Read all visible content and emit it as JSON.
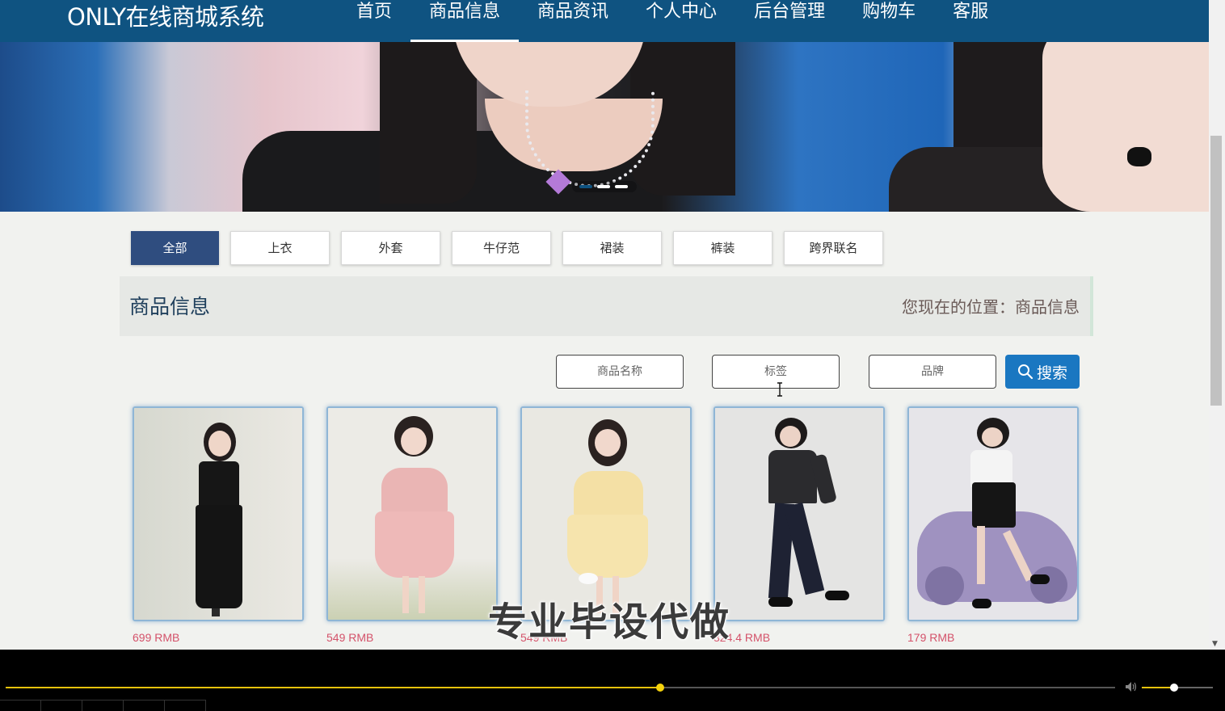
{
  "site": {
    "title": "ONLY在线商城系统"
  },
  "nav": {
    "items": [
      {
        "label": "首页"
      },
      {
        "label": "商品信息",
        "active": true
      },
      {
        "label": "商品资讯"
      },
      {
        "label": "个人中心"
      },
      {
        "label": "后台管理"
      },
      {
        "label": "购物车"
      },
      {
        "label": "客服"
      }
    ]
  },
  "banner": {
    "slides": 3,
    "active_slide": 1
  },
  "categories": [
    {
      "label": "全部",
      "active": true
    },
    {
      "label": "上衣"
    },
    {
      "label": "外套"
    },
    {
      "label": "牛仔范"
    },
    {
      "label": "裙装"
    },
    {
      "label": "裤装"
    },
    {
      "label": "跨界联名"
    }
  ],
  "section": {
    "title": "商品信息",
    "breadcrumb": "您现在的位置：商品信息"
  },
  "search": {
    "name_placeholder": "商品名称",
    "tag_placeholder": "标签",
    "brand_placeholder": "品牌",
    "button_label": "搜索",
    "button_icon": "search-icon"
  },
  "products": [
    {
      "price": "699 RMB"
    },
    {
      "price": "549 RMB"
    },
    {
      "price": "549 RMB"
    },
    {
      "price": "324.4 RMB"
    },
    {
      "price": "179 RMB"
    }
  ],
  "watermark": "专业毕设代做",
  "player": {
    "progress": 0.59,
    "volume": 0.45
  },
  "colors": {
    "nav_bg": "#0f5381",
    "active_tab": "#2f4d7f",
    "search_button": "#1a77c1",
    "price": "#d4526a",
    "seek": "#e6c20c"
  }
}
